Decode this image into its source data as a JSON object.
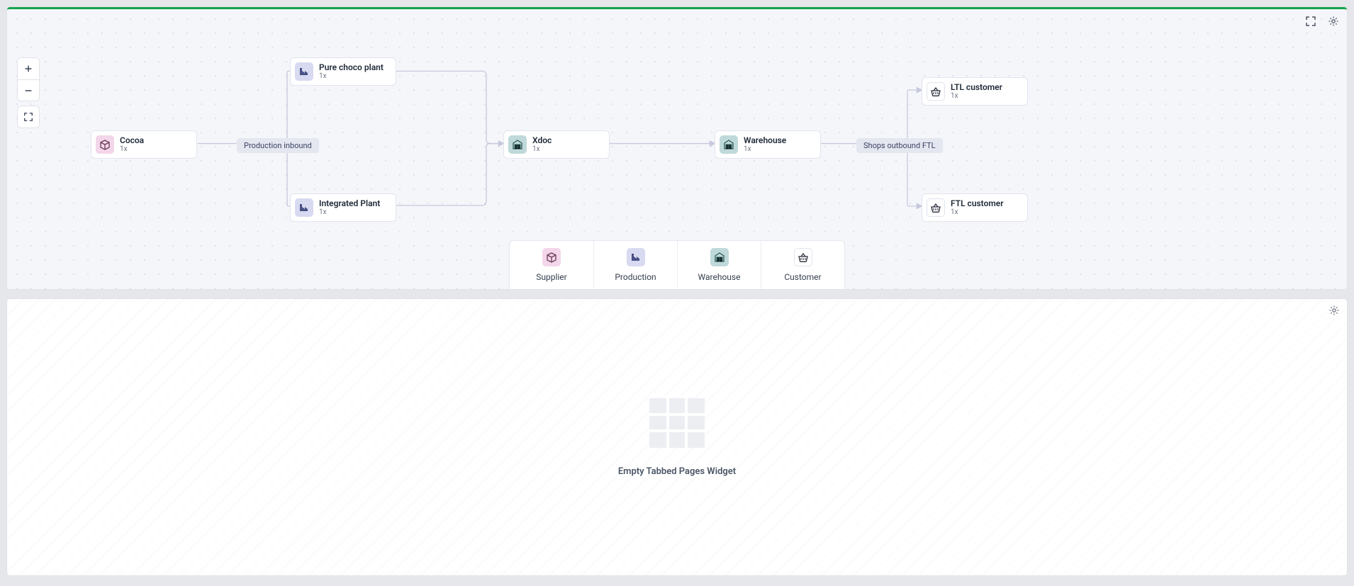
{
  "nodes": {
    "cocoa": {
      "title": "Cocoa",
      "sub": "1x"
    },
    "pure_choco": {
      "title": "Pure choco plant",
      "sub": "1x"
    },
    "integrated": {
      "title": "Integrated Plant",
      "sub": "1x"
    },
    "xdoc": {
      "title": "Xdoc",
      "sub": "1x"
    },
    "warehouse": {
      "title": "Warehouse",
      "sub": "1x"
    },
    "ltl_customer": {
      "title": "LTL customer",
      "sub": "1x"
    },
    "ftl_customer": {
      "title": "FTL customer",
      "sub": "1x"
    }
  },
  "edge_labels": {
    "production_inbound": "Production inbound",
    "shops_outbound_ftl": "Shops outbound FTL"
  },
  "palette": {
    "supplier": "Supplier",
    "production": "Production",
    "warehouse": "Warehouse",
    "customer": "Customer"
  },
  "empty_widget": {
    "text": "Empty Tabbed Pages Widget"
  }
}
